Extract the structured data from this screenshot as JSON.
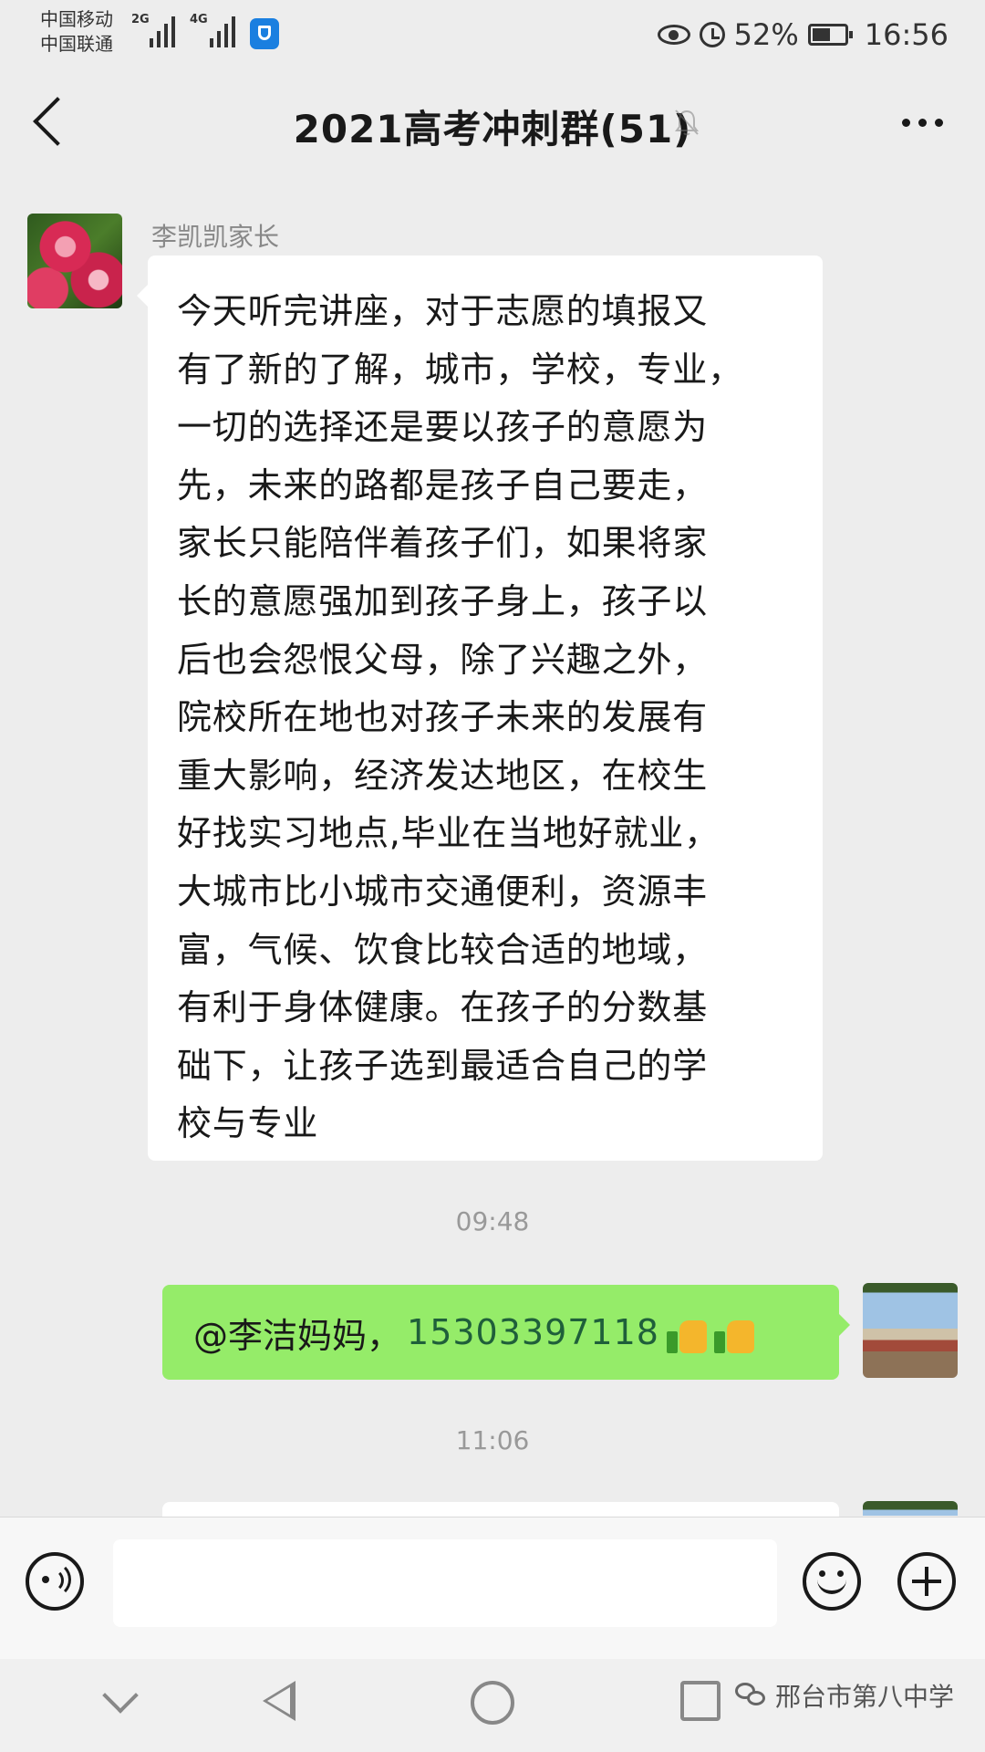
{
  "status_bar": {
    "carrier_1": "中国移动",
    "carrier_2": "中国联通",
    "network_1": "2G",
    "network_2": "4G",
    "battery_text": "52%",
    "battery_level": 0.52,
    "time": "16:56",
    "icons": [
      "signal-icon",
      "shield-app-icon",
      "eye-icon",
      "alarm-icon",
      "battery-icon"
    ]
  },
  "nav": {
    "title": "2021高考冲刺群(51)",
    "icons": [
      "back-arrow-icon",
      "mute-bell-icon",
      "more-dots-icon"
    ]
  },
  "messages": [
    {
      "side": "left",
      "sender": "李凯凯家长",
      "avatar": "flower-avatar",
      "lines": [
        "今天听完讲座，对于志愿的填报又",
        "有了新的了解，城市，学校，专业，",
        "一切的选择还是要以孩子的意愿为",
        "先，未来的路都是孩子自己要走，",
        "家长只能陪伴着孩子们，如果将家",
        "长的意愿强加到孩子身上，孩子以",
        "后也会怨恨父母，除了兴趣之外，",
        "院校所在地也对孩子未来的发展有",
        "重大影响，经济发达地区，在校生",
        "好找实习地点,毕业在当地好就业，",
        "大城市比小城市交通便利，资源丰",
        "富，气候、饮食比较合适的地域，",
        "有利于身体健康。在孩子的分数基",
        "础下，让孩子选到最适合自己的学",
        "校与专业"
      ]
    },
    {
      "side": "time",
      "text": "09:48"
    },
    {
      "side": "right",
      "avatar": "palace-avatar",
      "mention": "@李洁妈妈，",
      "phone": "15303397118",
      "emoji": [
        "thumbs-up-emoji",
        "thumbs-up-emoji"
      ]
    },
    {
      "side": "time",
      "text": "11:06"
    }
  ],
  "input_bar": {
    "icons": [
      "voice-icon",
      "emoji-icon",
      "plus-icon"
    ]
  },
  "system_nav": {
    "icons": [
      "nav-down-icon",
      "nav-back-icon",
      "nav-home-icon",
      "nav-recent-icon"
    ],
    "watermark": "邢台市第八中学"
  }
}
